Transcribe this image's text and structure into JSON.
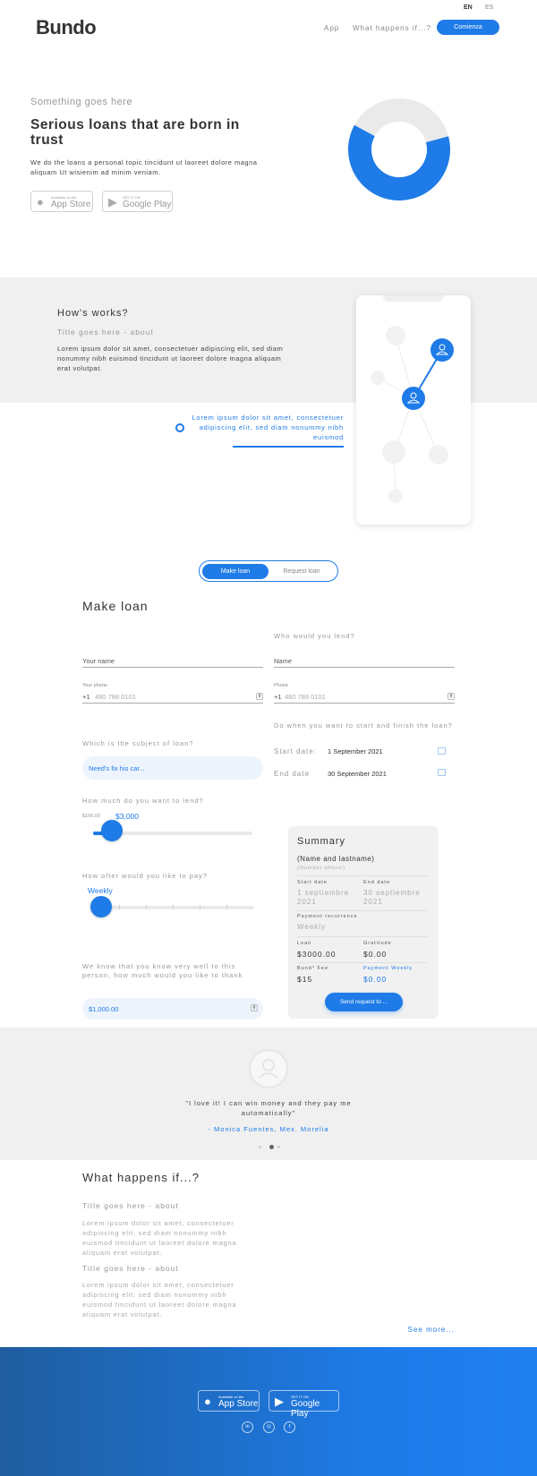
{
  "header": {
    "logo": "Bundo",
    "lang_en": "EN",
    "lang_es": "ES",
    "nav_app": "App",
    "nav_what": "What happens if...?",
    "cta": "Comienza"
  },
  "hero": {
    "kicker": "Something goes here",
    "title": "Serious loans that are born in trust",
    "text": "We do the loans a personal topic tincidunt ut laoreet dolore magna aliquam Ut wisienim ad minim veniam.",
    "appstore_small": "Available on the",
    "appstore_big": "App Store",
    "gplay_small": "GET IT ON",
    "gplay_big": "Google Play",
    "donut_fraction": 0.62
  },
  "how": {
    "title": "How's works?",
    "subtitle": "Title goes here - about",
    "text": "Lorem ipsum dolor sit amet, consectetuer adipiscing elit, sed diam nonummy nibh euismod tincidunt ut laoreet dolore magna aliquam erat volutpat.",
    "quote": "Lorem ipsum dolor sit amet, consectetuer adipiscing elit, sed diam nonummy nibh euismod"
  },
  "tabs": {
    "make": "Make loan",
    "request": "Request loan"
  },
  "form": {
    "title": "Make loan",
    "who_lend": "Who would you lend?",
    "your_name": "Your name",
    "name": "Name",
    "your_phone": "Your phone",
    "phone": "Phone",
    "phone_prefix": "+1",
    "phone_placeholder": "480 788 0101",
    "when_label": "Do when you want to start and finish the loan?",
    "start_label": "Start date:",
    "start_value": "1 September 2021",
    "end_label": "End date",
    "end_value": "30 September 2021",
    "subject_label": "Which is the subject of loan?",
    "subject_value": "Need's fix his car...",
    "much_label": "How much do you want to lend?",
    "much_min": "$100.00",
    "much_value": "$3,000",
    "much_fraction": 0.12,
    "often_label": "How ofter would you like to pay?",
    "often_value": "Weekly",
    "thank_label": "We know that you know very well to this person, how much would you like to thank",
    "thank_value": "$1,000.00"
  },
  "summary": {
    "title": "Summary",
    "name": "(Name and lastname)",
    "phone": "(Number phone)",
    "start_label": "Start date",
    "start_value": "1 septiembre 2021",
    "end_label": "End date",
    "end_value": "30 septiembre 2021",
    "recurrence_label": "Payment recurrence",
    "recurrence_value": "Weekly",
    "loan_label": "Loan",
    "loan_value": "$3000.00",
    "gratitude_label": "Gratitude",
    "gratitude_value": "$0.00",
    "fee_label": "Bund° Fee",
    "fee_value": "$15",
    "weekly_label": "Payment Weekly",
    "weekly_value": "$0.00",
    "send": "Send request to ..."
  },
  "testimonial": {
    "quote": "\"I love it! I can win money and they pay me automatically\"",
    "author": "- Monica Fuentes, Mex. Morelia"
  },
  "what": {
    "title": "What happens if...?",
    "sub1": "Title goes here - about",
    "text1": "Lorem ipsum dolor sit amet, consectetuer adipiscing elit, sed diam nonummy nibh euismod tincidunt ut laoreet dolore magna aliquam erat volutpat.",
    "sub2": "Title goes here - about",
    "text2": "Lorem ipsum dolor sit amet, consectetuer adipiscing elit, sed diam nonummy nibh euismod tincidunt ut laoreet dolore magna aliquam erat volutpat.",
    "see_more": "See more..."
  },
  "footer": {
    "appstore_small": "Available on the",
    "appstore_big": "App Store",
    "gplay_small": "GET IT ON",
    "gplay_big": "Google Play",
    "social_in": "in",
    "social_ig": "◎",
    "social_fb": "f"
  },
  "colors": {
    "accent": "#1e7be8",
    "band": "#f0f0f0"
  }
}
